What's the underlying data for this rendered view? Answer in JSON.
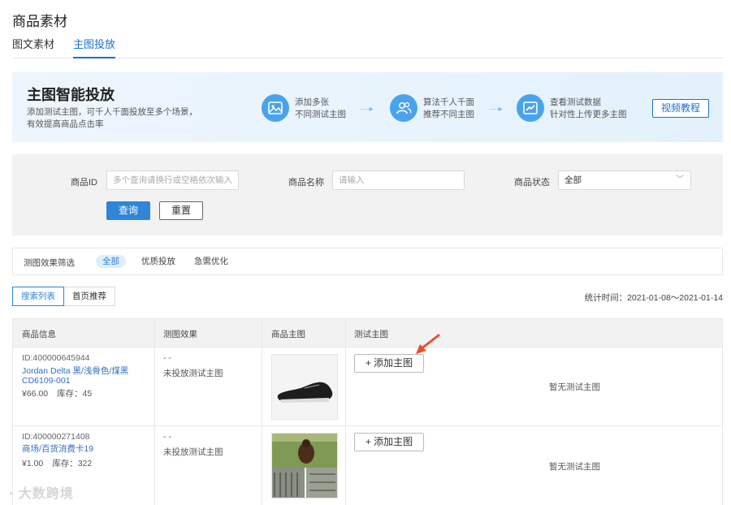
{
  "page": {
    "title": "商品素材"
  },
  "tabs": [
    {
      "label": "图文素材"
    },
    {
      "label": "主图投放"
    }
  ],
  "banner": {
    "title": "主图智能投放",
    "desc_line1": "添加测试主图，可千人千面投放至多个场景，",
    "desc_line2": "有效提高商品点击率",
    "steps": [
      {
        "icon": "image-icon",
        "line1": "添加多张",
        "line2": "不同测试主图"
      },
      {
        "icon": "users-icon",
        "line1": "算法千人千面",
        "line2": "推荐不同主图"
      },
      {
        "icon": "chart-icon",
        "line1": "查看测试数据",
        "line2": "针对性上传更多主图"
      }
    ],
    "arrow": "·····▸",
    "video_label": "视频教程"
  },
  "filter": {
    "product_id_label": "商品ID",
    "product_id_placeholder": "多个查询请换行或空格依次输入",
    "product_name_label": "商品名称",
    "product_name_placeholder": "请输入",
    "status_label": "商品状态",
    "status_value": "全部",
    "query_label": "查询",
    "reset_label": "重置"
  },
  "effect_filter": {
    "label": "测图效果筛选",
    "options": [
      "全部",
      "优质投放",
      "急需优化"
    ]
  },
  "list_tabs": [
    "搜索列表",
    "首页推荐"
  ],
  "stat_time": "统计时间：2021-01-08～2021-01-14",
  "table": {
    "headers": [
      "商品信息",
      "测图效果",
      "商品主图",
      "测试主图"
    ],
    "rows": [
      {
        "id": "ID:400000645944",
        "name": "Jordan Delta 黑/浅骨色/煤黑 CD6109-001",
        "price": "¥66.00",
        "stock": "库存：45",
        "effect1": "- -",
        "effect2": "未投放测试主图",
        "add_label": "+ 添加主图",
        "empty_text": "暂无测试主图"
      },
      {
        "id": "ID:400000271408",
        "name": "商场/百货消费卡19",
        "price": "¥1.00",
        "stock": "库存：322",
        "effect1": "- -",
        "effect2": "未投放测试主图",
        "add_label": "+ 添加主图",
        "empty_text": "暂无测试主图"
      }
    ]
  },
  "watermark": "大数跨境",
  "colors": {
    "accent": "#2f86d9",
    "arrow": "#e8502a",
    "banner_icon": "#4aa3ea"
  }
}
